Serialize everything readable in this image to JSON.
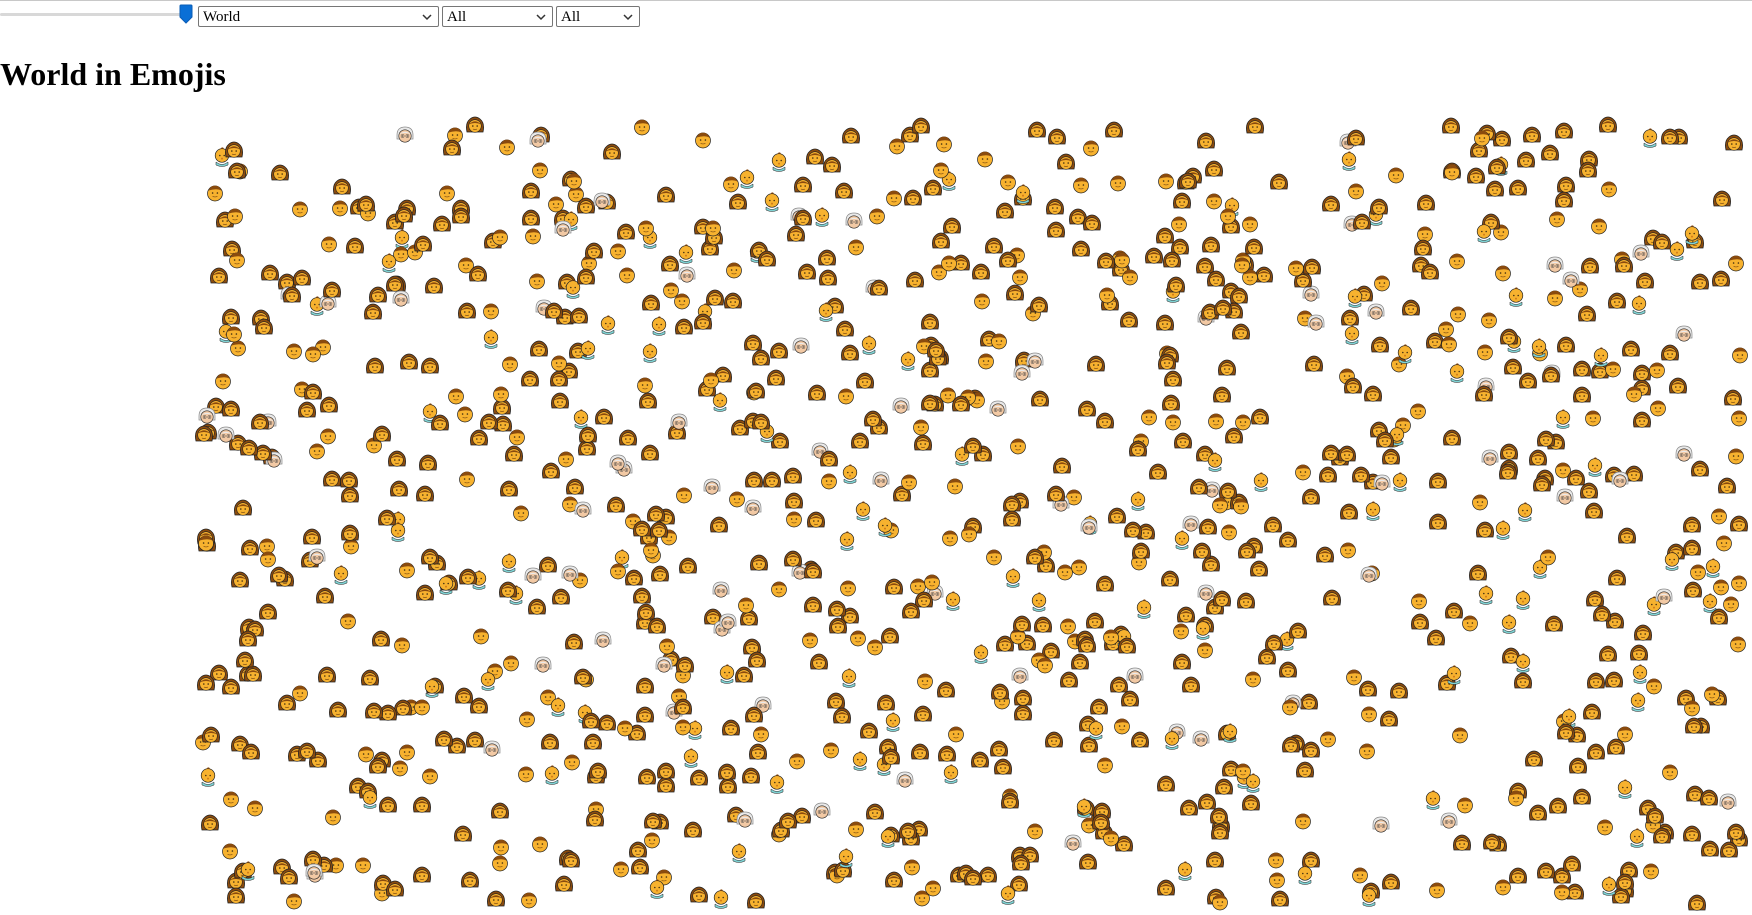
{
  "controls": {
    "slider_value": 1.0,
    "region": {
      "selected": "World"
    },
    "filter_a": {
      "selected": "All"
    },
    "filter_b": {
      "selected": "All"
    }
  },
  "page_title": "World in Emojis",
  "people_field": {
    "glyph_types": [
      "woman-emoji-icon",
      "man-emoji-icon",
      "child-emoji-icon",
      "older-person-emoji-icon"
    ],
    "colors": {
      "skin": "#F7B22F",
      "hair": "#8A4B0E",
      "elder_face": "#F2C9A4",
      "elder_hair": "#E9E9E9",
      "baby_clothes": "#7FD3D4",
      "outline": "#222222"
    }
  }
}
